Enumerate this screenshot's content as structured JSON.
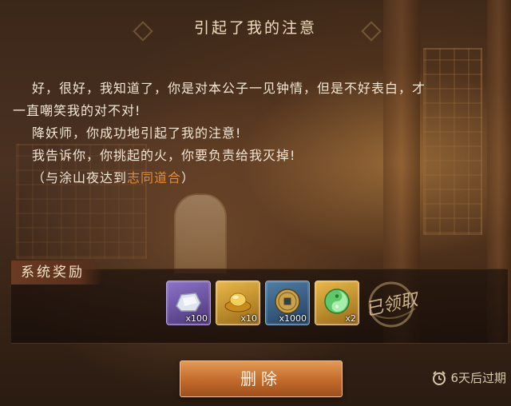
{
  "dialog": {
    "title": "引起了我的注意",
    "story_lines": [
      "好，很好，我知道了，你是对本公子一见钟情，但是不好表白，才",
      "一直嘲笑我的对不对!",
      "降妖师，你成功地引起了我的注意!",
      "我告诉你，你挑起的火，你要负责给我灭掉!"
    ],
    "bond_prefix": "（与涂山夜达到",
    "bond_highlight": "志同道合",
    "bond_suffix": "）"
  },
  "rewards": {
    "header": "系统奖励",
    "items": [
      {
        "name": "silver-ingot",
        "count": "x100",
        "rarity_color": "#8d74c9"
      },
      {
        "name": "gold-ingot",
        "count": "x10",
        "rarity_color": "#e9b949"
      },
      {
        "name": "copper-coin",
        "count": "x1000",
        "rarity_color": "#4f7fa8"
      },
      {
        "name": "jade-orb",
        "count": "x2",
        "rarity_color": "#e9b949"
      }
    ],
    "claimed_stamp": "已领取"
  },
  "actions": {
    "delete_label": "删除"
  },
  "expiry": {
    "icon": "alarm-clock-icon",
    "text": "6天后过期"
  },
  "colors": {
    "highlight": "#e08a3a",
    "button": "#c26a2b"
  }
}
